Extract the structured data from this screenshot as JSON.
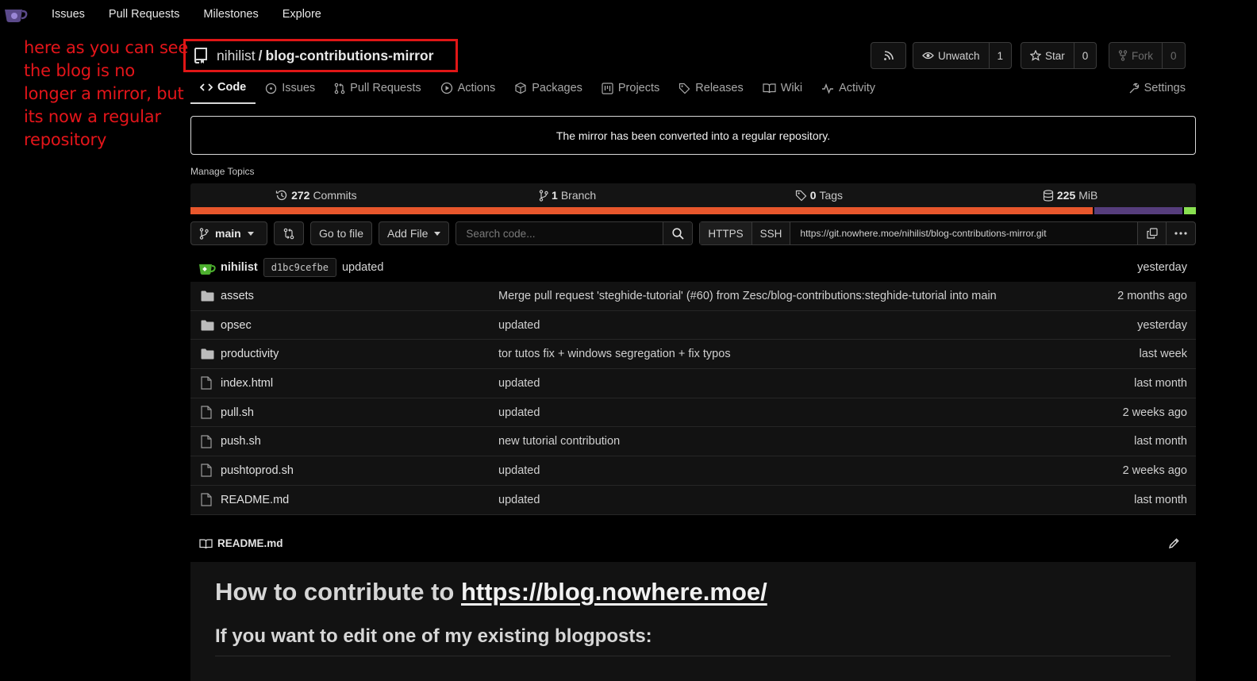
{
  "nav": {
    "items": [
      "Issues",
      "Pull Requests",
      "Milestones",
      "Explore"
    ]
  },
  "annotation": {
    "text": "here as you can see the blog is no longer a mirror, but its now a regular repository",
    "color": "#e4151a"
  },
  "repo": {
    "owner": "nihilist",
    "separator": "/",
    "name": "blog-contributions-mirror"
  },
  "actions": {
    "unwatch_label": "Unwatch",
    "watch_count": "1",
    "star_label": "Star",
    "star_count": "0",
    "fork_label": "Fork",
    "fork_count": "0"
  },
  "tabs": {
    "code": "Code",
    "issues": "Issues",
    "pulls": "Pull Requests",
    "actions": "Actions",
    "packages": "Packages",
    "projects": "Projects",
    "releases": "Releases",
    "wiki": "Wiki",
    "activity": "Activity",
    "settings": "Settings"
  },
  "flash": "The mirror has been converted into a regular repository.",
  "manage_topics": "Manage Topics",
  "stats": {
    "commits_count": "272",
    "commits_label": "Commits",
    "branch_count": "1",
    "branch_label": "Branch",
    "tags_count": "0",
    "tags_label": "Tags",
    "size_value": "225",
    "size_unit": "MiB"
  },
  "language_bar": [
    {
      "share": 0.9,
      "color": "#e8572c"
    },
    {
      "share": 0.088,
      "color": "#563d7c"
    },
    {
      "share": 0.012,
      "color": "#89e051"
    }
  ],
  "toolbar": {
    "branch": "main",
    "goto_file": "Go to file",
    "add_file": "Add File",
    "search_placeholder": "Search code...",
    "https": "HTTPS",
    "ssh": "SSH",
    "clone_url": "https://git.nowhere.moe/nihilist/blog-contributions-mirror.git"
  },
  "latest_commit": {
    "author": "nihilist",
    "sha": "d1bc9cefbe",
    "message": "updated",
    "time": "yesterday"
  },
  "files": [
    {
      "type": "folder",
      "name": "assets",
      "message": "Merge pull request 'steghide-tutorial' (#60) from Zesc/blog-contributions:steghide-tutorial into main",
      "time": "2 months ago"
    },
    {
      "type": "folder",
      "name": "opsec",
      "message": "updated",
      "time": "yesterday"
    },
    {
      "type": "folder",
      "name": "productivity",
      "message": "tor tutos fix + windows segregation + fix typos",
      "time": "last week"
    },
    {
      "type": "file",
      "name": "index.html",
      "message": "updated",
      "time": "last month"
    },
    {
      "type": "file",
      "name": "pull.sh",
      "message": "updated",
      "time": "2 weeks ago"
    },
    {
      "type": "file",
      "name": "push.sh",
      "message": "new tutorial contribution",
      "time": "last month"
    },
    {
      "type": "file",
      "name": "pushtoprod.sh",
      "message": "updated",
      "time": "2 weeks ago"
    },
    {
      "type": "file",
      "name": "README.md",
      "message": "updated",
      "time": "last month"
    }
  ],
  "readme": {
    "title": "README.md",
    "h1_prefix": "How to contribute to ",
    "h1_link": "https://blog.nowhere.moe/",
    "h2": "If you want to edit one of my existing blogposts:"
  }
}
